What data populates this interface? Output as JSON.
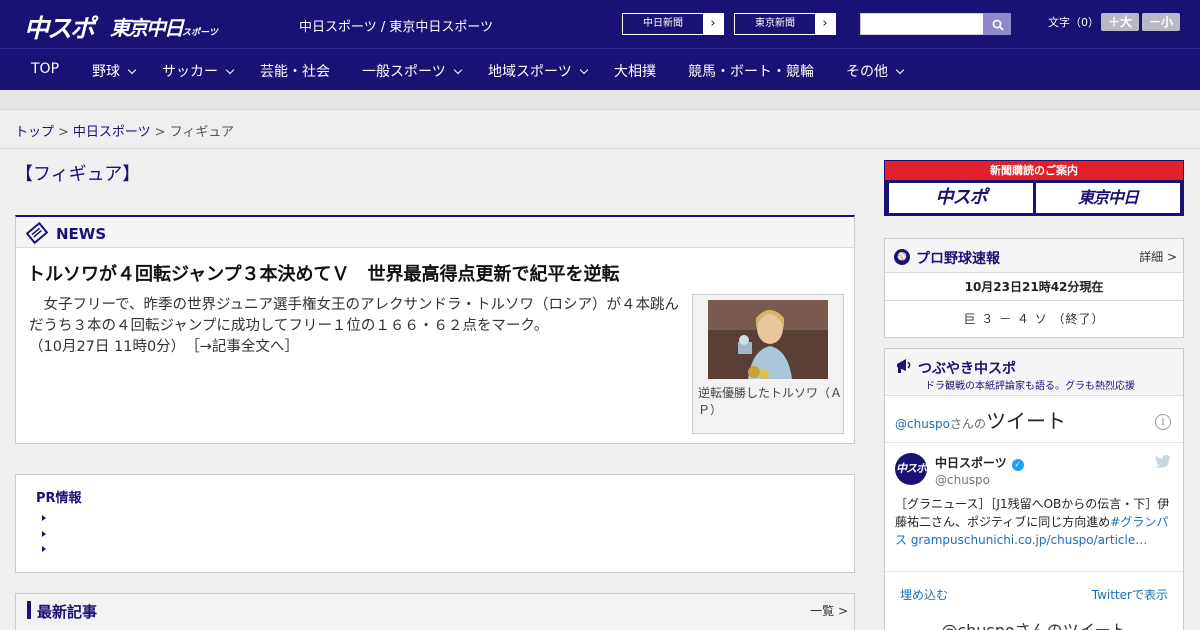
{
  "header": {
    "logo_chuspo": "中スポ",
    "logo_tokyo": "東京中日",
    "logo_tokyo_small": "スポーツ",
    "site_name": "中日スポーツ / 東京中日スポーツ",
    "ext_links": [
      {
        "label": "中日新聞"
      },
      {
        "label": "東京新聞"
      }
    ],
    "search": {
      "placeholder": "",
      "value": ""
    },
    "font_size_label": "文字（0）",
    "font_up": "＋大",
    "font_down": "－小",
    "brand_color": "#1a1175"
  },
  "nav": {
    "items": [
      {
        "label": "TOP",
        "dropdown": false
      },
      {
        "label": "野球",
        "dropdown": true
      },
      {
        "label": "サッカー",
        "dropdown": true
      },
      {
        "label": "芸能・社会",
        "dropdown": false
      },
      {
        "label": "一般スポーツ",
        "dropdown": true
      },
      {
        "label": "地域スポーツ",
        "dropdown": true
      },
      {
        "label": "大相撲",
        "dropdown": false
      },
      {
        "label": "競馬・ボート・競輪",
        "dropdown": false
      },
      {
        "label": "その他",
        "dropdown": true
      }
    ]
  },
  "breadcrumb": {
    "items": [
      "トップ",
      "中日スポーツ",
      "フィギュア"
    ],
    "separator": ">"
  },
  "page_heading": "【フィギュア】",
  "news": {
    "section_title": "NEWS",
    "headline": "トルソワが４回転ジャンプ３本決めてＶ　世界最高得点更新で紀平を逆転",
    "body": "　女子フリーで、昨季の世界ジュニア選手権女王のアレクサンドラ・トルソワ（ロシア）が４本跳んだうち３本の４回転ジャンプに成功してフリー１位の１６６・６２点をマーク。",
    "timestamp": "（10月27日 11時0分）",
    "more_link": "［→記事全文へ］",
    "photo_caption": "逆転優勝したトルソワ（ＡＰ）"
  },
  "pr": {
    "title": "PR情報",
    "items": [
      "",
      "",
      ""
    ]
  },
  "latest": {
    "title": "最新記事",
    "more": "一覧 >"
  },
  "subscribe_banner": {
    "title": "新聞購読のご案内",
    "left": "中スポ",
    "right": "東京中日"
  },
  "baseball": {
    "title": "プロ野球速報",
    "detail": "詳細 >",
    "updated": "10月23日21時42分現在",
    "score": "巨 ３ － ４ ソ （終了）"
  },
  "tweets": {
    "title": "つぶやき中スポ",
    "subtitle": "ドラ観戦の本紙評論家も語る。グラも熱烈応援",
    "handle_prefix": "@chuspo",
    "handle_suffix": "さんの",
    "tweets_word": "ツイート",
    "account_name": "中日スポーツ",
    "account_handle": "@chuspo",
    "avatar_text": "中スポ",
    "tweet_text": "［グラニュース］［J1残留へOBからの伝言・下］伊藤祐二さん、ポジティブに同じ方向進め",
    "tweet_link": "#グランパス grampuschunichi.co.jp/chuspo/article…",
    "embed": "埋め込む",
    "view_on_twitter": "Twitterで表示",
    "footer": "@chuspoさんのツイート"
  }
}
